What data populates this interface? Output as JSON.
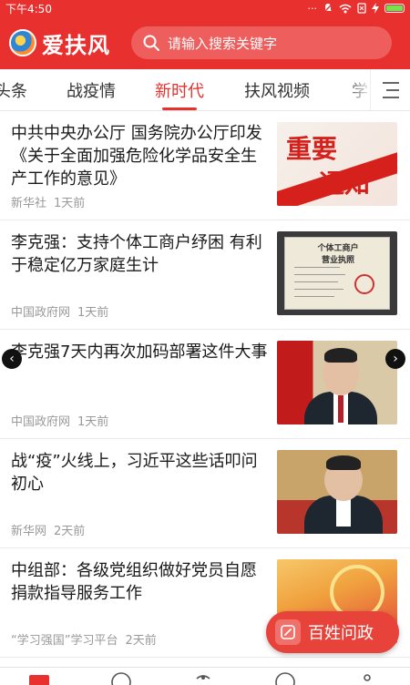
{
  "status_bar": {
    "time": "下午4:50",
    "icons": [
      "dots-icon",
      "bell-off-icon",
      "wifi-icon",
      "sim-icon",
      "bolt-icon",
      "battery-icon"
    ]
  },
  "header": {
    "app_name": "爱扶风",
    "search_placeholder": "请输入搜索关键字"
  },
  "tabs": [
    {
      "label": "头条",
      "active": false
    },
    {
      "label": "战疫情",
      "active": false
    },
    {
      "label": "新时代",
      "active": true
    },
    {
      "label": "扶风视频",
      "active": false
    },
    {
      "label": "学",
      "active": false
    }
  ],
  "news": [
    {
      "title": "中共中央办公厅 国务院办公厅印发《关于全面加强危险化学品安全生产工作的意见》",
      "source": "新华社",
      "time": "1天前",
      "thumb_text": [
        "重要",
        "通知"
      ]
    },
    {
      "title": "李克强：支持个体工商户纾困 有利于稳定亿万家庭生计",
      "source": "中国政府网",
      "time": "1天前",
      "thumb_text": [
        "个体工商户",
        "营业执照"
      ]
    },
    {
      "title": "李克强7天内再次加码部署这件大事",
      "source": "中国政府网",
      "time": "1天前"
    },
    {
      "title": "战“疫”火线上，习近平这些话叩问初心",
      "source": "新华网",
      "time": "2天前"
    },
    {
      "title": "中组部：各级党组织做好党员自愿捐款指导服务工作",
      "source": "“学习强国”学习平台",
      "time": "2天前"
    }
  ],
  "floating_button": {
    "label": "百姓问政"
  },
  "colors": {
    "brand_red": "#e8312f",
    "meta_gray": "#999999"
  }
}
